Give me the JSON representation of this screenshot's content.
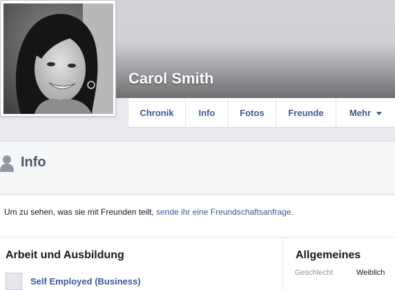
{
  "profile": {
    "name": "Carol Smith"
  },
  "nav": {
    "tabs": [
      {
        "label": "Chronik"
      },
      {
        "label": "Info"
      },
      {
        "label": "Fotos"
      },
      {
        "label": "Freunde"
      },
      {
        "label": "Mehr"
      }
    ]
  },
  "info_section": {
    "title": "Info"
  },
  "notice": {
    "text": "Um zu sehen, was sie mit Freunden teilt, ",
    "link": "sende ihr eine Freundschaftsanfrage",
    "suffix": "."
  },
  "work": {
    "title": "Arbeit und Ausbildung",
    "entry": "Self Employed (Business)"
  },
  "general": {
    "title": "Allgemeines",
    "label": "Geschlecht",
    "value": "Weiblich"
  },
  "colors": {
    "link": "#3b5998",
    "heading": "#4e5665",
    "muted": "#90949c"
  }
}
